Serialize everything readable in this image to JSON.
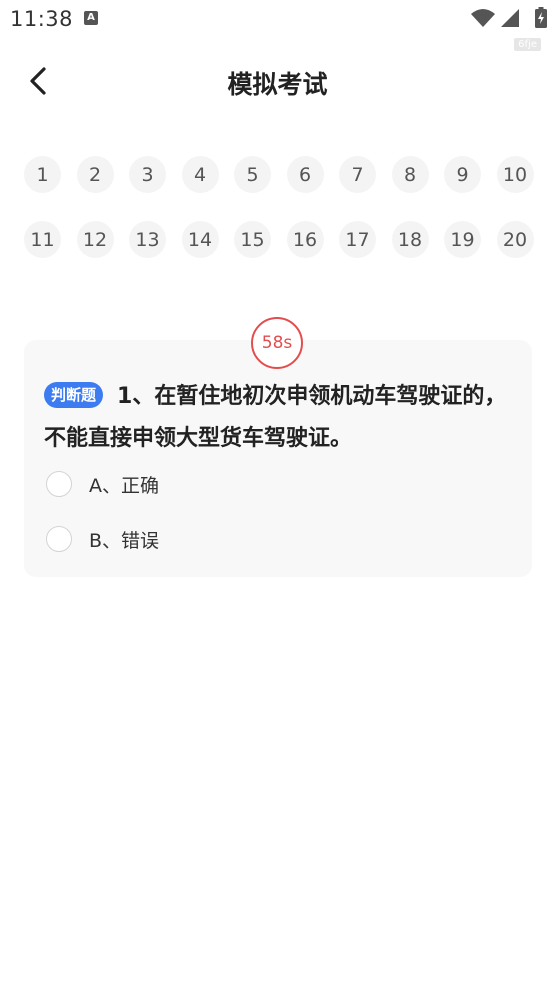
{
  "status_bar": {
    "time": "11:38",
    "notification_glyph": "A",
    "watermark": "6fje",
    "icons": [
      "wifi-icon",
      "signal-icon",
      "battery-charging-icon"
    ]
  },
  "header": {
    "back_icon": "chevron-left-icon",
    "title": "模拟考试"
  },
  "question_nav": [
    "1",
    "2",
    "3",
    "4",
    "5",
    "6",
    "7",
    "8",
    "9",
    "10",
    "11",
    "12",
    "13",
    "14",
    "15",
    "16",
    "17",
    "18",
    "19",
    "20"
  ],
  "timer": "58s",
  "question": {
    "type": "判断题",
    "text": "1、在暂住地初次申领机动车驾驶证的，不能直接申领大型货车驾驶证。",
    "options": [
      "A、正确",
      "B、错误"
    ]
  },
  "colors": {
    "accent_blue": "#3c7cf0",
    "timer_red": "#e34d4d",
    "card_bg": "#f8f8f8",
    "nav_bg": "#f4f4f4"
  }
}
